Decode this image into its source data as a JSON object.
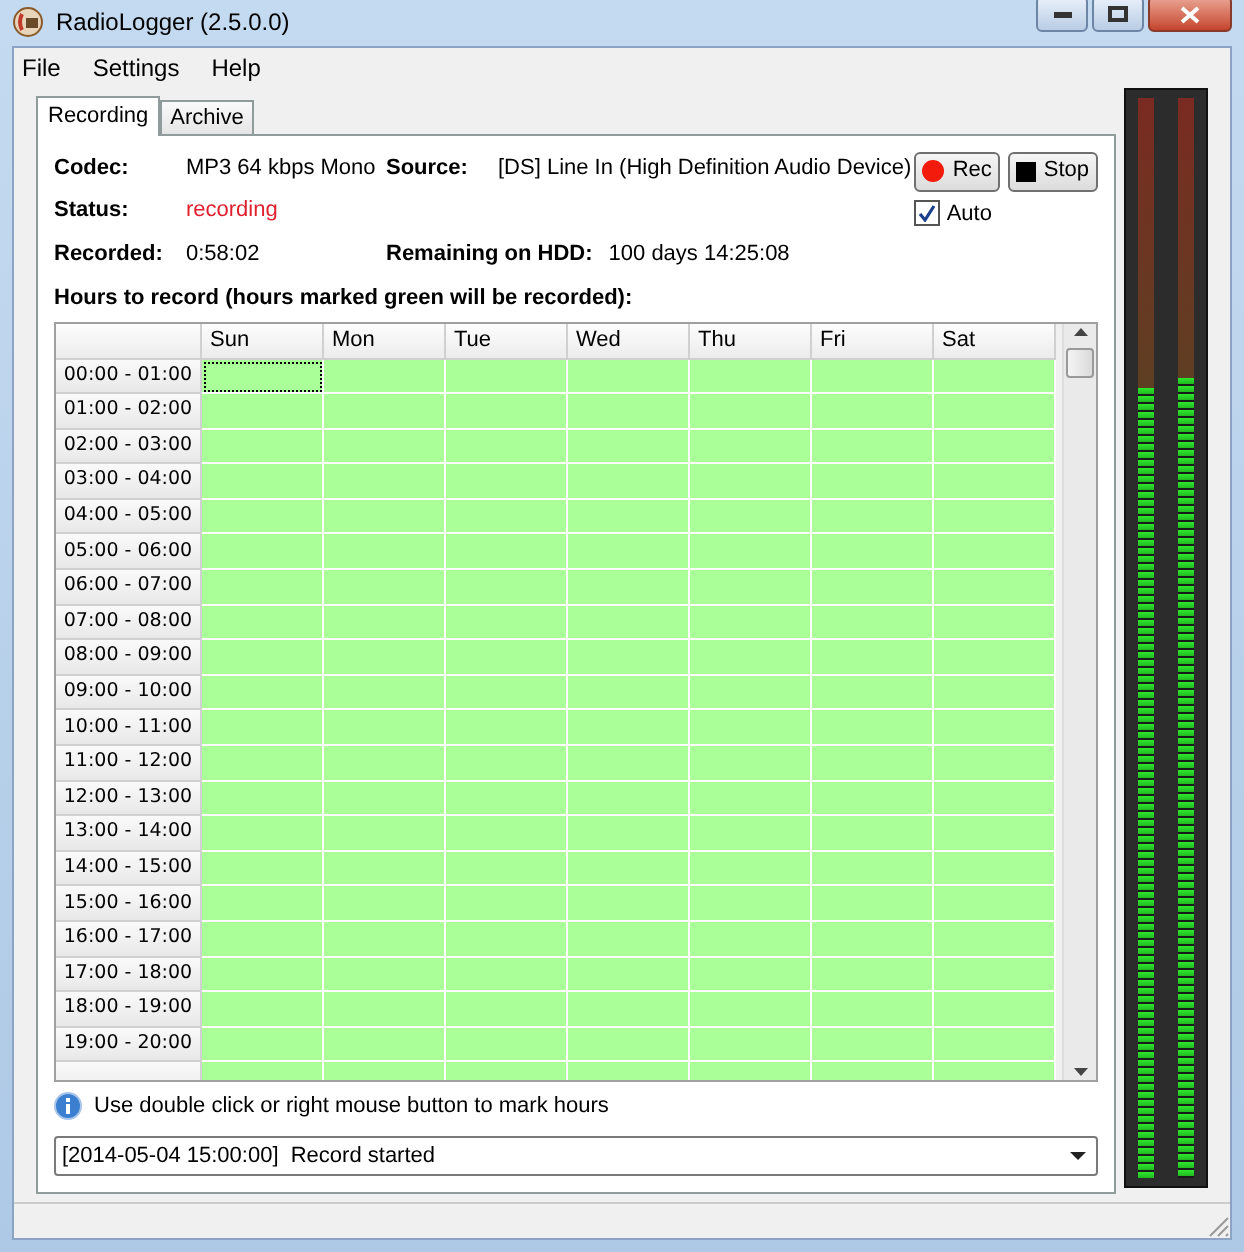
{
  "window": {
    "title": "RadioLogger (2.5.0.0)"
  },
  "menu": [
    "File",
    "Settings",
    "Help"
  ],
  "tabs": [
    {
      "label": "Recording",
      "selected": true
    },
    {
      "label": "Archive",
      "selected": false
    }
  ],
  "info": {
    "codec_label": "Codec:",
    "codec": "MP3 64 kbps Mono",
    "source_label": "Source:",
    "source": "[DS] Line In (High Definition Audio Device)",
    "status_label": "Status:",
    "status": "recording",
    "recorded_label": "Recorded:",
    "recorded": "0:58:02",
    "remaining_label": "Remaining on HDD:",
    "remaining": "100 days 14:25:08"
  },
  "buttons": [
    {
      "kind": "rec",
      "label": "Rec"
    },
    {
      "kind": "stop",
      "label": "Stop"
    }
  ],
  "auto": {
    "label": "Auto",
    "checked": true
  },
  "schedule": {
    "title": "Hours to record (hours marked green will be recorded):",
    "days": [
      "Sun",
      "Mon",
      "Tue",
      "Wed",
      "Thu",
      "Fri",
      "Sat"
    ],
    "rows": [
      {
        "label": "00:00 - 01:00",
        "marked": [
          true,
          true,
          true,
          true,
          true,
          true,
          true
        ],
        "focused": [
          true,
          false,
          false,
          false,
          false,
          false,
          false
        ]
      },
      {
        "label": "01:00 - 02:00",
        "marked": [
          true,
          true,
          true,
          true,
          true,
          true,
          true
        ]
      },
      {
        "label": "02:00 - 03:00",
        "marked": [
          true,
          true,
          true,
          true,
          true,
          true,
          true
        ]
      },
      {
        "label": "03:00 - 04:00",
        "marked": [
          true,
          true,
          true,
          true,
          true,
          true,
          true
        ]
      },
      {
        "label": "04:00 - 05:00",
        "marked": [
          true,
          true,
          true,
          true,
          true,
          true,
          true
        ]
      },
      {
        "label": "05:00 - 06:00",
        "marked": [
          true,
          true,
          true,
          true,
          true,
          true,
          true
        ]
      },
      {
        "label": "06:00 - 07:00",
        "marked": [
          true,
          true,
          true,
          true,
          true,
          true,
          true
        ]
      },
      {
        "label": "07:00 - 08:00",
        "marked": [
          true,
          true,
          true,
          true,
          true,
          true,
          true
        ]
      },
      {
        "label": "08:00 - 09:00",
        "marked": [
          true,
          true,
          true,
          true,
          true,
          true,
          true
        ]
      },
      {
        "label": "09:00 - 10:00",
        "marked": [
          true,
          true,
          true,
          true,
          true,
          true,
          true
        ]
      },
      {
        "label": "10:00 - 11:00",
        "marked": [
          true,
          true,
          true,
          true,
          true,
          true,
          true
        ]
      },
      {
        "label": "11:00 - 12:00",
        "marked": [
          true,
          true,
          true,
          true,
          true,
          true,
          true
        ]
      },
      {
        "label": "12:00 - 13:00",
        "marked": [
          true,
          true,
          true,
          true,
          true,
          true,
          true
        ]
      },
      {
        "label": "13:00 - 14:00",
        "marked": [
          true,
          true,
          true,
          true,
          true,
          true,
          true
        ]
      },
      {
        "label": "14:00 - 15:00",
        "marked": [
          true,
          true,
          true,
          true,
          true,
          true,
          true
        ]
      },
      {
        "label": "15:00 - 16:00",
        "marked": [
          true,
          true,
          true,
          true,
          true,
          true,
          true
        ]
      },
      {
        "label": "16:00 - 17:00",
        "marked": [
          true,
          true,
          true,
          true,
          true,
          true,
          true
        ]
      },
      {
        "label": "17:00 - 18:00",
        "marked": [
          true,
          true,
          true,
          true,
          true,
          true,
          true
        ]
      },
      {
        "label": "18:00 - 19:00",
        "marked": [
          true,
          true,
          true,
          true,
          true,
          true,
          true
        ]
      },
      {
        "label": "19:00 - 20:00",
        "marked": [
          true,
          true,
          true,
          true,
          true,
          true,
          true
        ]
      }
    ]
  },
  "hint": "Use double click or right mouse button to mark hours",
  "log": {
    "value": "[2014-05-04 15:00:00]  Record started"
  },
  "meter": [
    {
      "level": 0.73
    },
    {
      "level": 0.74
    }
  ]
}
